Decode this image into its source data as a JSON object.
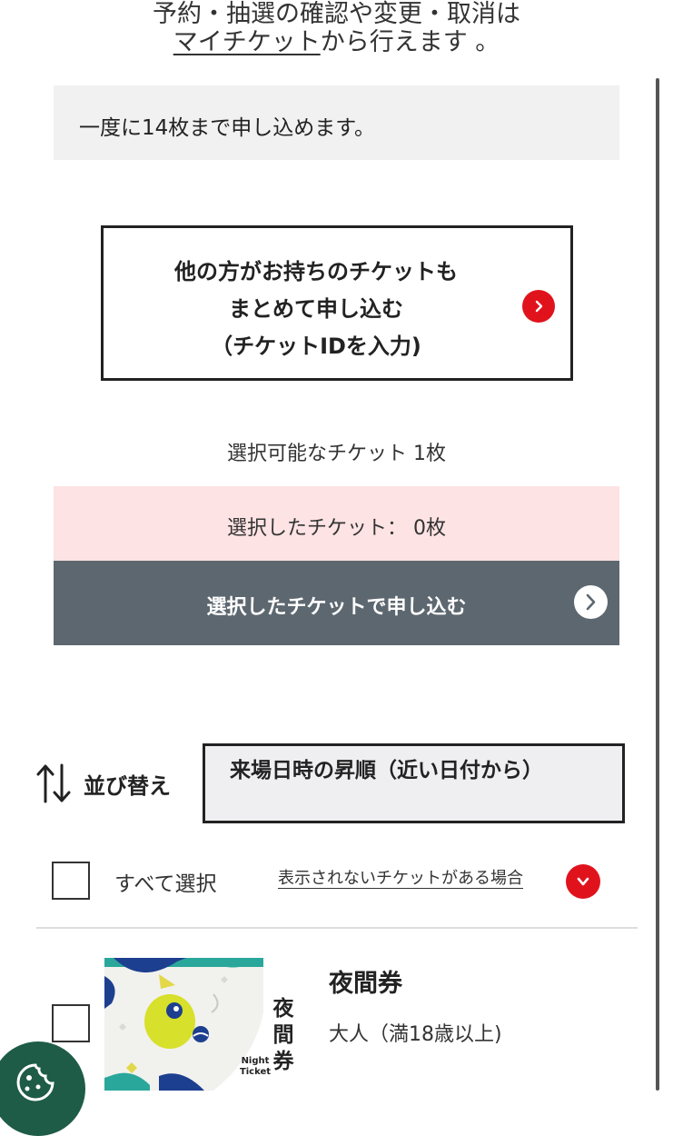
{
  "notice": {
    "line1": "予約・抽選の確認や変更・取消は",
    "link": "マイチケット",
    "line2_rest": "から行えます 。"
  },
  "limit_text": "一度に14枚まで申し込めます。",
  "other_tickets_button": {
    "line1": "他の方がお持ちのチケットも",
    "line2": "まとめて申し込む",
    "line3": "（チケットIDを入力)"
  },
  "available_text": "選択可能なチケット 1枚",
  "selected_text": "選択したチケット： 0枚",
  "apply_button": "選択したチケットで申し込む",
  "sort": {
    "label": "並び替え",
    "value": "来場日時の昇順（近い日付から）"
  },
  "select_all_label": "すべて選択",
  "hidden_tickets_link": "表示されないチケットがある場合",
  "ticket": {
    "title": "夜間券",
    "category": "大人（満18歳以上)",
    "thumb_text": "夜間券",
    "thumb_small": "Night Ticket"
  },
  "colors": {
    "accent_red": "#e0131d",
    "apply_bg": "#5d6770",
    "selected_bg": "#fde3e4",
    "limit_bg": "#f1f1f2",
    "fab_bg": "#1e5c47"
  }
}
